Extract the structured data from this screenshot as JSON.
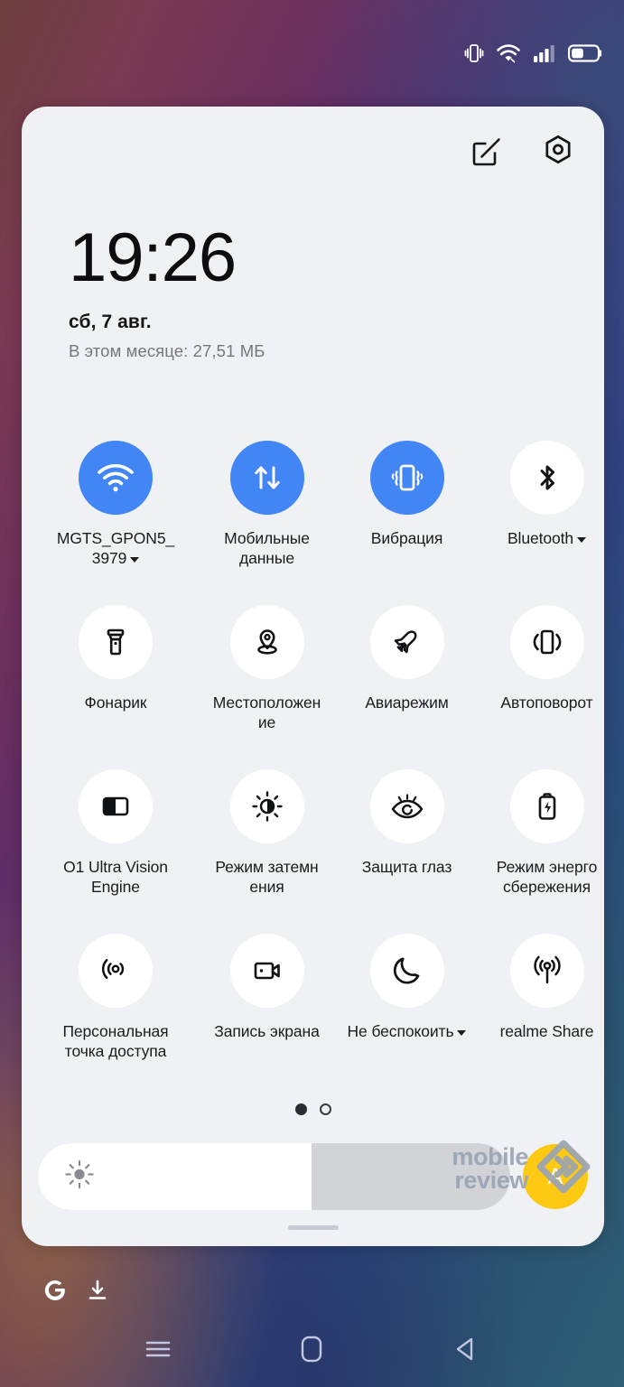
{
  "statusbar": {
    "icons": [
      {
        "name": "vibrate-icon",
        "label": "Вибрация"
      },
      {
        "name": "wifi-icon",
        "label": "Wi-Fi"
      },
      {
        "name": "signal-bars-icon",
        "label": "Сигнал"
      },
      {
        "name": "battery-icon",
        "label": "Батарея"
      }
    ]
  },
  "panel": {
    "actions": [
      {
        "name": "edit-icon",
        "label": "Изменить"
      },
      {
        "name": "settings-gear-icon",
        "label": "Настройки"
      }
    ],
    "clock": "19:26",
    "date": "сб, 7 авг.",
    "data_usage": "В этом месяце: 27,51 МБ",
    "page_dots": {
      "total": 2,
      "active_index": 0
    },
    "drag_handle_label": "Свернуть панель"
  },
  "tiles": [
    {
      "id": "wifi",
      "icon": "wifi-icon",
      "label": "MGTS_GPON5_\n3979",
      "active": true,
      "has_caret": true
    },
    {
      "id": "mobile-data",
      "icon": "mobile-data-icon",
      "label": "Мобильные данные",
      "active": true,
      "has_caret": false
    },
    {
      "id": "vibration",
      "icon": "vibration-phone-icon",
      "label": "Вибрация",
      "active": true,
      "has_caret": false
    },
    {
      "id": "bluetooth",
      "icon": "bluetooth-icon",
      "label": "Bluetooth",
      "active": false,
      "has_caret": true
    },
    {
      "id": "flashlight",
      "icon": "flashlight-icon",
      "label": "Фонарик",
      "active": false,
      "has_caret": false
    },
    {
      "id": "location",
      "icon": "location-pin-icon",
      "label": "Местоположен\nие",
      "active": false,
      "has_caret": false
    },
    {
      "id": "airplane-mode",
      "icon": "airplane-icon",
      "label": "Авиарежим",
      "active": false,
      "has_caret": false
    },
    {
      "id": "auto-rotate",
      "icon": "auto-rotate-icon",
      "label": "Автоповорот",
      "active": false,
      "has_caret": false
    },
    {
      "id": "o1-ultra-vision-engine",
      "icon": "split-screen-contrast-icon",
      "label": "O1 Ultra Vision\nEngine",
      "active": false,
      "has_caret": false
    },
    {
      "id": "dark-mode",
      "icon": "brightness-contrast-icon",
      "label": "Режим затемн\nения",
      "active": false,
      "has_caret": false
    },
    {
      "id": "eye-comfort",
      "icon": "eye-protect-icon",
      "label": "Защита глаз",
      "active": false,
      "has_caret": false
    },
    {
      "id": "power-saving",
      "icon": "battery-saver-icon",
      "label": "Режим энерго\nсбережения",
      "active": false,
      "has_caret": false
    },
    {
      "id": "hotspot",
      "icon": "hotspot-icon",
      "label": "Персональная\nточка доступа",
      "active": false,
      "has_caret": false
    },
    {
      "id": "screen-record",
      "icon": "screen-record-icon",
      "label": "Запись экрана",
      "active": false,
      "has_caret": false
    },
    {
      "id": "do-not-disturb",
      "icon": "moon-icon",
      "label": "Не беспокоить",
      "active": false,
      "has_caret": true
    },
    {
      "id": "realme-share",
      "icon": "share-broadcast-icon",
      "label": "realme Share",
      "active": false,
      "has_caret": false
    }
  ],
  "brightness": {
    "icon": "sun-icon",
    "value_percent": 58,
    "auto_label": "A",
    "auto_icon": "auto-brightness-icon"
  },
  "watermark": {
    "line1": "mobile",
    "line2": "review",
    "logo": "diamond-chevron-logo"
  },
  "home_shortcuts": [
    {
      "name": "google-g-icon",
      "label": "Google"
    },
    {
      "name": "download-icon",
      "label": "Загрузки"
    }
  ],
  "navbar": [
    {
      "name": "recents-menu-icon",
      "label": "Недавние"
    },
    {
      "name": "home-icon",
      "label": "Главный экран"
    },
    {
      "name": "back-icon",
      "label": "Назад"
    }
  ],
  "colors": {
    "accent_blue": "#4285f4",
    "panel_bg": "#f0f1f5",
    "tile_bg": "#ffffff",
    "auto_yellow": "#fdc913",
    "text_primary": "#1b1c20",
    "text_muted": "#76777d"
  }
}
